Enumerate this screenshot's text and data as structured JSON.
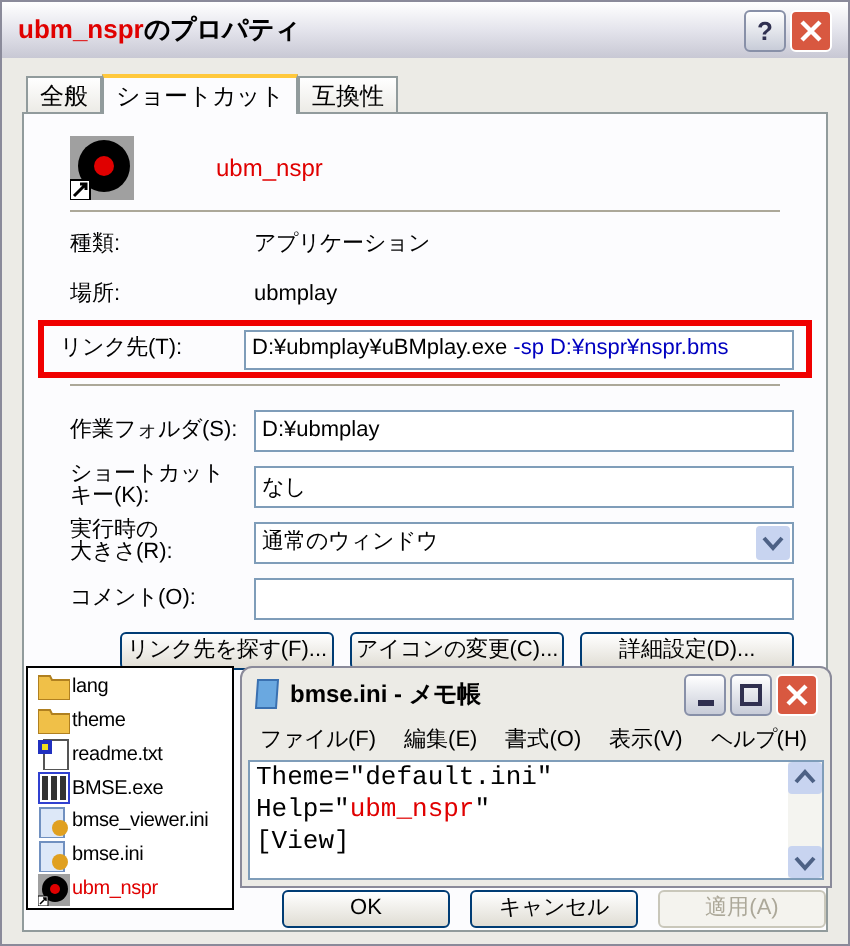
{
  "window": {
    "title_name": "ubm_nspr",
    "title_suffix": "のプロパティ",
    "help_button": "?"
  },
  "tabs": [
    {
      "label": "全般",
      "selected": false
    },
    {
      "label": "ショートカット",
      "selected": true
    },
    {
      "label": "互換性",
      "selected": false
    }
  ],
  "shortcut_name": "ubm_nspr",
  "info": [
    {
      "label": "種類:",
      "value": "アプリケーション"
    },
    {
      "label": "場所:",
      "value": "ubmplay"
    }
  ],
  "link_target": {
    "label": "リンク先(T):",
    "path": "D:¥ubmplay¥uBMplay.exe",
    "args": " -sp D:¥nspr¥nspr.bms",
    "highlighted": true
  },
  "fields": [
    {
      "kind": "text",
      "label_lines": [
        "作業フォルダ(S):"
      ],
      "value": "D:¥ubmplay"
    },
    {
      "kind": "text",
      "label_lines": [
        "ショートカット",
        "キー(K):"
      ],
      "value": "なし"
    },
    {
      "kind": "select",
      "label_lines": [
        "実行時の",
        "大きさ(R):"
      ],
      "value": "通常のウィンドウ"
    },
    {
      "kind": "text",
      "label_lines": [
        "コメント(O):"
      ]
    }
  ],
  "action_buttons": [
    "リンク先を探す(F)...",
    "アイコンの変更(C)...",
    "詳細設定(D)..."
  ],
  "dialog_buttons": [
    {
      "label": "OK",
      "disabled": false
    },
    {
      "label": "キャンセル",
      "disabled": false
    },
    {
      "label": "適用(A)",
      "disabled": true
    }
  ],
  "file_list": [
    {
      "kind": "folder",
      "name": "lang",
      "marked": false
    },
    {
      "kind": "folder",
      "name": "theme",
      "marked": false
    },
    {
      "kind": "text",
      "name": "readme.txt",
      "marked": false
    },
    {
      "kind": "exe",
      "name": "BMSE.exe",
      "marked": false
    },
    {
      "kind": "ini",
      "name": "bmse_viewer.ini",
      "marked": false
    },
    {
      "kind": "ini",
      "name": "bmse.ini",
      "marked": false
    },
    {
      "kind": "shortcut",
      "name": "ubm_nspr",
      "marked": true
    }
  ],
  "notepad": {
    "title": "bmse.ini - メモ帳",
    "menu": [
      "ファイル(F)",
      "編集(E)",
      "書式(O)",
      "表示(V)",
      "ヘルプ(H)"
    ],
    "lines": [
      [
        {
          "text": "Theme=\"default.ini\"",
          "highlight": false
        }
      ],
      [
        {
          "text": "Help=\"",
          "highlight": false
        },
        {
          "text": "ubm_nspr",
          "highlight": true
        },
        {
          "text": "\"",
          "highlight": false
        }
      ],
      [
        {
          "text": "[View]",
          "highlight": false
        }
      ]
    ]
  }
}
